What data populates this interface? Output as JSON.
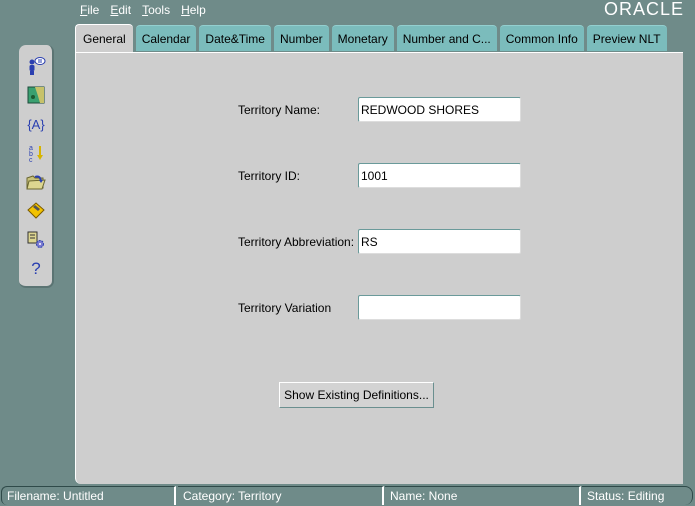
{
  "menubar": {
    "items": [
      {
        "label": "File",
        "mnemonic": "F",
        "rest": "ile"
      },
      {
        "label": "Edit",
        "mnemonic": "E",
        "rest": "dit"
      },
      {
        "label": "Tools",
        "mnemonic": "T",
        "rest": "ools"
      },
      {
        "label": "Help",
        "mnemonic": "H",
        "rest": "elp"
      }
    ]
  },
  "brand": {
    "logo_text": "ORACLE"
  },
  "tabs": [
    {
      "label": "General",
      "active": true
    },
    {
      "label": "Calendar",
      "active": false
    },
    {
      "label": "Date&Time",
      "active": false
    },
    {
      "label": "Number",
      "active": false
    },
    {
      "label": "Monetary",
      "active": false
    },
    {
      "label": "Number and C...",
      "active": false
    },
    {
      "label": "Common Info",
      "active": false
    },
    {
      "label": "Preview NLT",
      "active": false
    }
  ],
  "toolbar": {
    "items": [
      {
        "icon": "person-comment-icon",
        "tooltip": ""
      },
      {
        "icon": "map-icon",
        "tooltip": ""
      },
      {
        "icon": "variable-braces-icon",
        "tooltip": ""
      },
      {
        "icon": "sort-abc-icon",
        "tooltip": ""
      },
      {
        "icon": "open-folder-icon",
        "tooltip": ""
      },
      {
        "icon": "save-disk-icon",
        "tooltip": ""
      },
      {
        "icon": "document-settings-icon",
        "tooltip": ""
      },
      {
        "icon": "help-icon",
        "tooltip": ""
      }
    ]
  },
  "form": {
    "territory_name": {
      "label": "Territory Name:",
      "value": "REDWOOD SHORES"
    },
    "territory_id": {
      "label": "Territory ID:",
      "value": "1001"
    },
    "territory_abbreviation": {
      "label": "Territory Abbreviation:",
      "value": "RS"
    },
    "territory_variation": {
      "label": "Territory Variation",
      "value": ""
    },
    "show_definitions_button": "Show Existing Definitions..."
  },
  "statusbar": {
    "filename": "Filename: Untitled",
    "category": "Category: Territory",
    "name": "Name: None",
    "status": "Status: Editing"
  }
}
